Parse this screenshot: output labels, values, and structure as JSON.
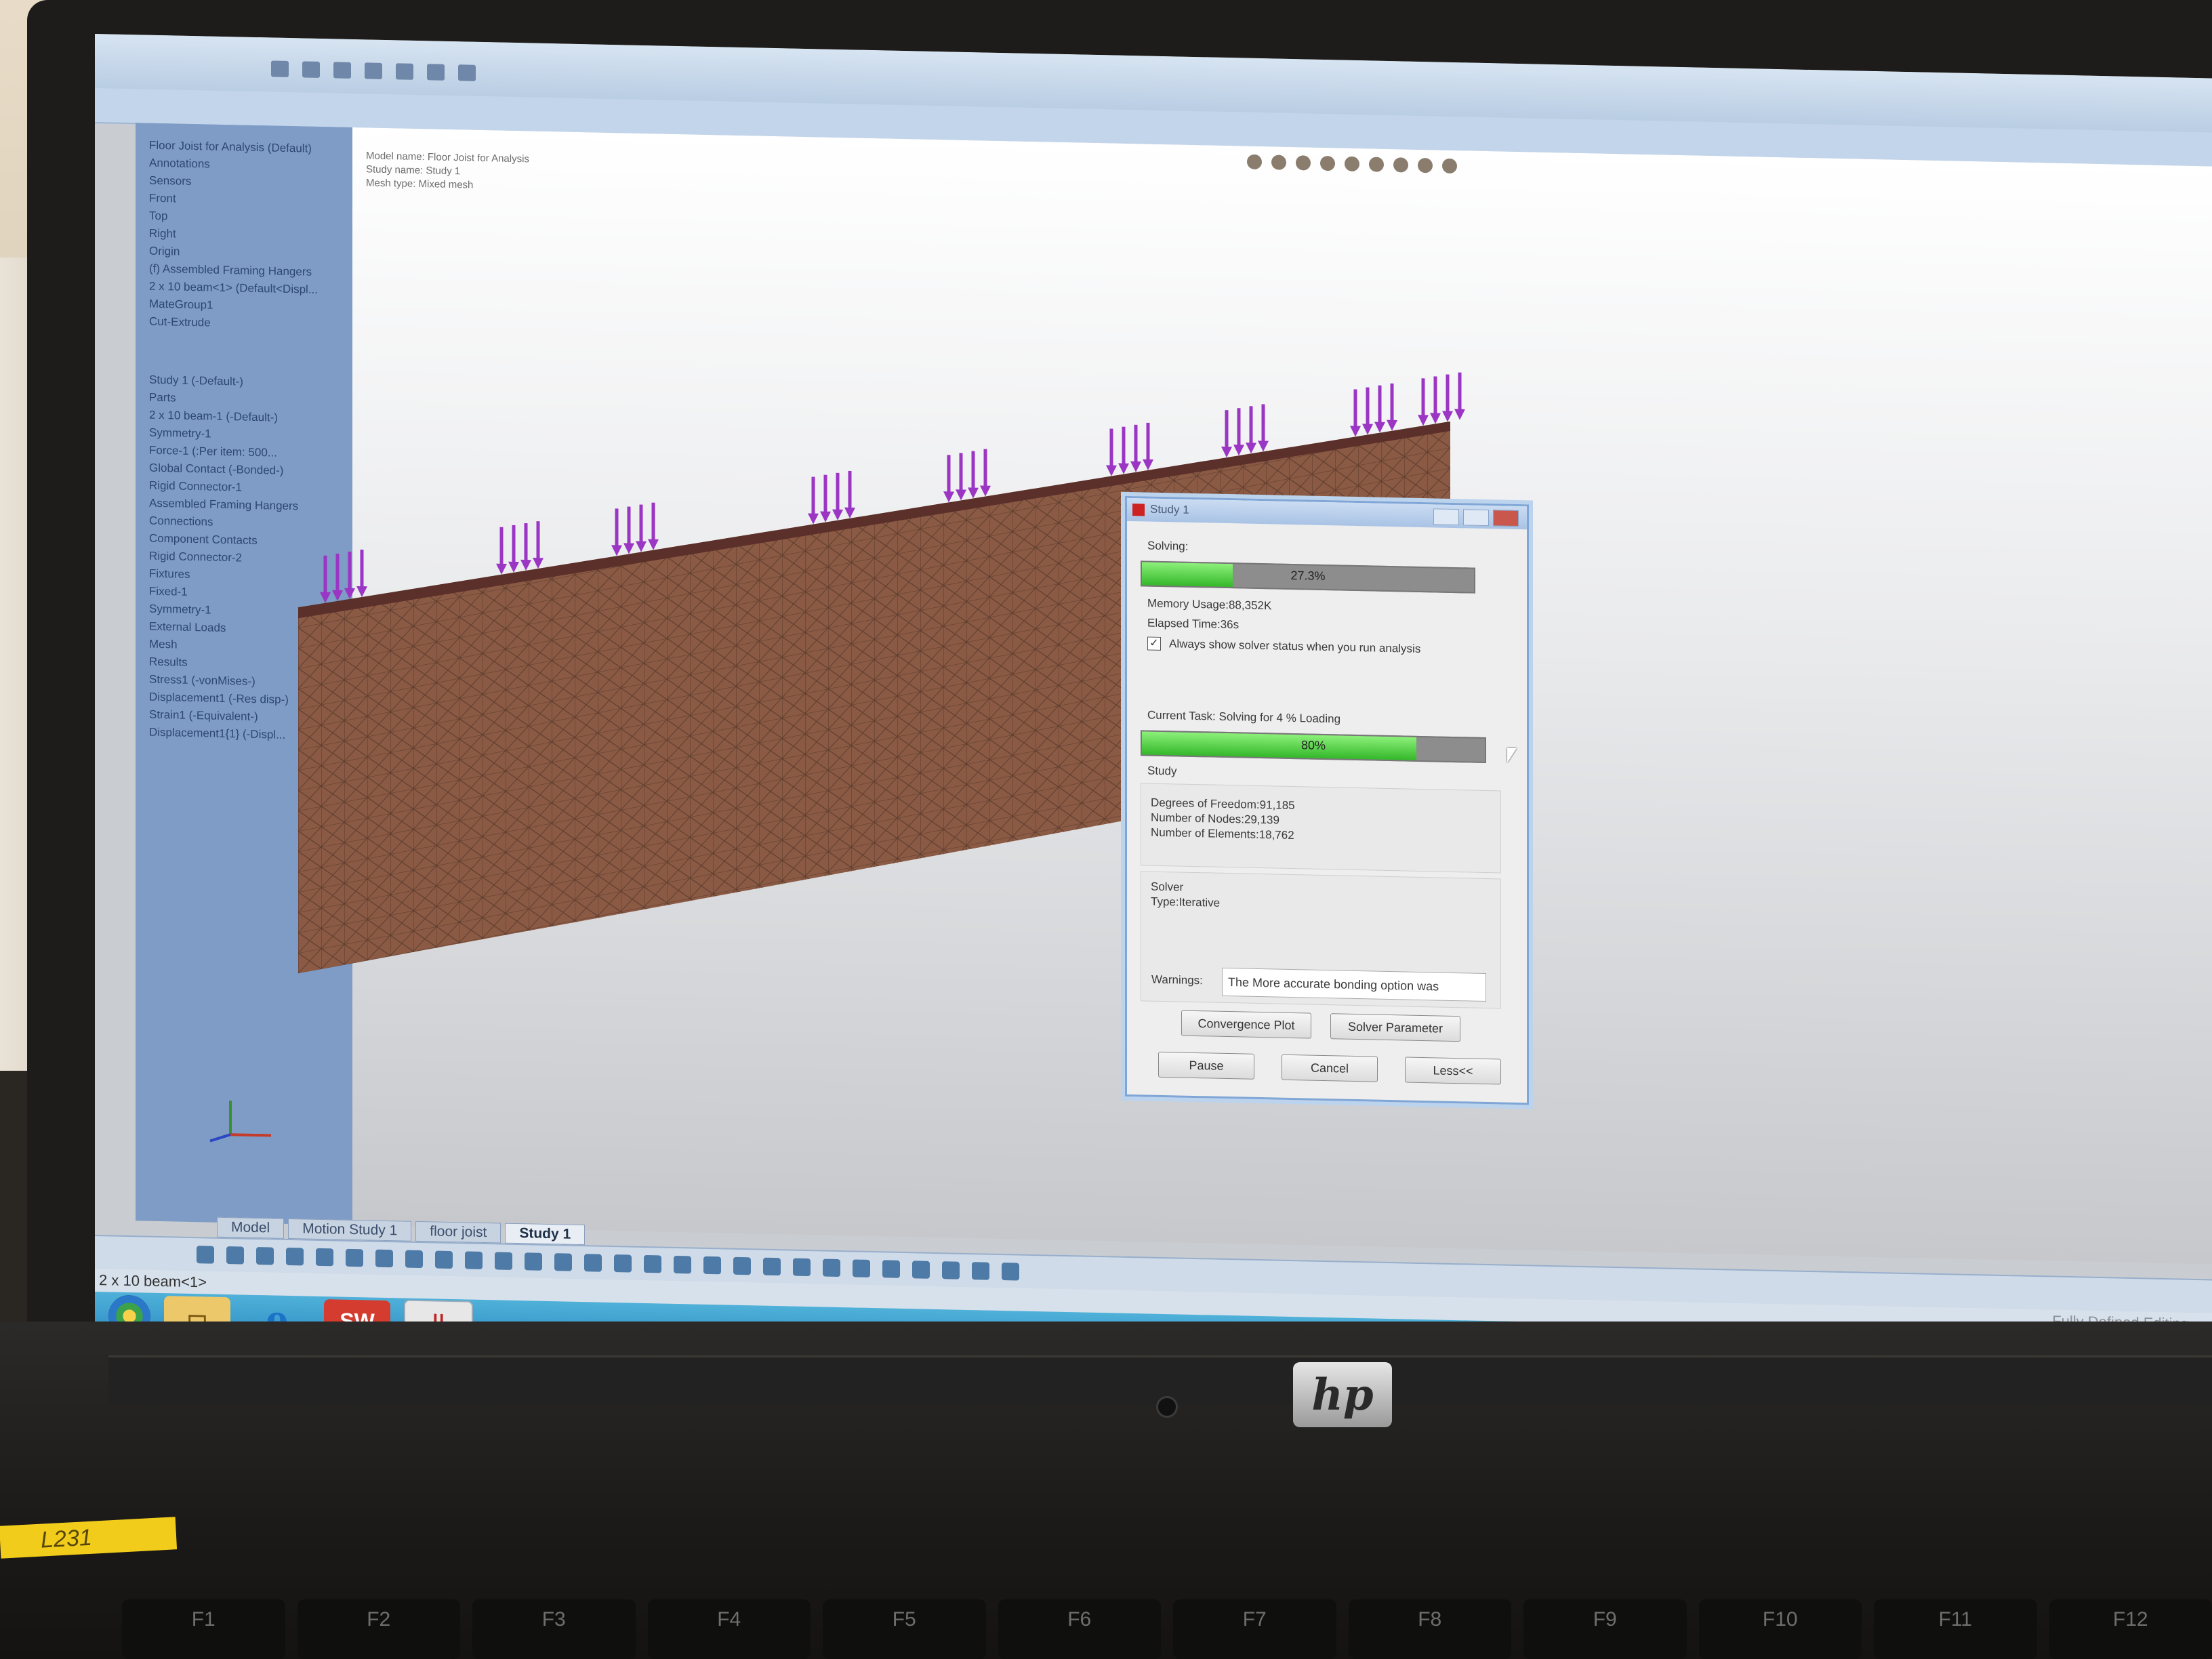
{
  "app": {
    "model_name": "Model name: Floor Joist for Analysis",
    "study_name": "Study name: Study 1",
    "mesh_type": "Mesh type: Mixed mesh",
    "tree_items": [
      "Floor Joist for Analysis (Default)",
      "Annotations",
      "Sensors",
      "Front",
      "Top",
      "Right",
      "Origin",
      "(f) Assembled Framing Hangers",
      "2 x 10 beam<1> (Default<Displ...",
      "MateGroup1",
      "Cut-Extrude"
    ],
    "study_tree": [
      "Study 1 (-Default-)",
      "Parts",
      "2 x 10 beam-1 (-Default-)",
      "Symmetry-1",
      "Force-1 (:Per item: 500...",
      "Global Contact (-Bonded-)",
      "Rigid Connector-1",
      "Assembled Framing Hangers",
      "Connections",
      "Component Contacts",
      "Rigid Connector-2",
      "Fixtures",
      "Fixed-1",
      "Symmetry-1",
      "External Loads",
      "Mesh",
      "Results",
      "Stress1 (-vonMises-)",
      "Displacement1 (-Res disp-)",
      "Strain1 (-Equivalent-)",
      "Displacement1{1} (-Displ..."
    ],
    "tabs": [
      "Model",
      "Motion Study 1",
      "floor joist",
      "Study 1"
    ],
    "status_left": "2 x 10 beam<1>",
    "status_right": "Fully Defined    Editing",
    "taskbar": [
      "start",
      "explorer",
      "internet-explorer",
      "solidworks",
      "simulation"
    ],
    "taskbar_labels": {
      "sw": "SW",
      "ie": "e"
    }
  },
  "dialog": {
    "title": "Study 1",
    "solving_label": "Solving:",
    "solving_progress": 0.273,
    "solving_pct": "27.3%",
    "memory_usage": "Memory Usage:88,352K",
    "elapsed_time": "Elapsed Time:36s",
    "always_show": "Always show solver status when you run analysis",
    "always_show_checked": true,
    "current_task": "Current Task: Solving for 4 % Loading",
    "task_progress": 0.8,
    "task_pct": "80%",
    "study_label": "Study",
    "dof": "Degrees of Freedom:91,185",
    "nodes": "Number of Nodes:29,139",
    "elements": "Number of Elements:18,762",
    "solver_label": "Solver",
    "solver_type": "Type:Iterative",
    "warnings_label": "Warnings:",
    "warning_text": "The More accurate bonding option was",
    "convergence_btn": "Convergence Plot",
    "solver_param_btn": "Solver Parameter",
    "pause_btn": "Pause",
    "cancel_btn": "Cancel",
    "less_btn": "Less<<"
  },
  "hardware": {
    "brand": "hp",
    "asset_tag": "L231",
    "fkeys": [
      "F1",
      "F2",
      "F3",
      "F4",
      "F5",
      "F6",
      "F7",
      "F8",
      "F9",
      "F10",
      "F11",
      "F12"
    ]
  },
  "colors": {
    "beam": "#8a5a44",
    "load_arrow": "#9a35c4",
    "progress": "#3fbf2f"
  }
}
